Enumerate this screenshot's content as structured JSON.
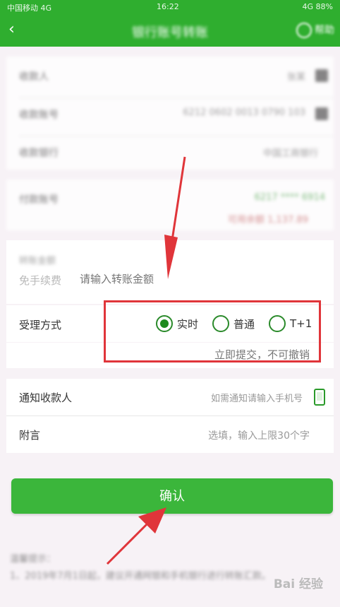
{
  "status_bar": {
    "left": "中国移动 4G",
    "time": "16:22",
    "right": "4G 88%"
  },
  "navbar": {
    "title": "银行账号转账",
    "help": "帮助"
  },
  "payee_section": {
    "rows": [
      {
        "label": "收款人",
        "value": "张某"
      },
      {
        "label": "收款账号",
        "value": "6212 0602 0013 0790 103"
      },
      {
        "label": "收款银行",
        "value": "中国工商银行"
      }
    ]
  },
  "payer_section": {
    "label": "付款账号",
    "account": "6217 **** 6914 ",
    "balance": "可用余额 1,137.89"
  },
  "amount_section": {
    "label": "转账金额",
    "fee_text": "免手续费",
    "placeholder": "请输入转账金额"
  },
  "accept_method": {
    "label": "受理方式",
    "options": [
      {
        "label": "实时",
        "selected": true
      },
      {
        "label": "普通",
        "selected": false
      },
      {
        "label": "T+1",
        "selected": false
      }
    ],
    "note": "立即提交，不可撤销"
  },
  "notify": {
    "label": "通知收款人",
    "placeholder": "如需通知请输入手机号"
  },
  "remark": {
    "label": "附言",
    "placeholder": "选填，输入上限30个字"
  },
  "confirm_button": "确认",
  "tips": {
    "title": "温馨提示：",
    "line1": "1、2019年7月1日起，建议开通网银和手机银行进行转账汇款。"
  },
  "watermark": "Bai 经验",
  "colors": {
    "green": "#2fae2f",
    "button": "#3bb63b",
    "highlight": "#e0353a"
  }
}
